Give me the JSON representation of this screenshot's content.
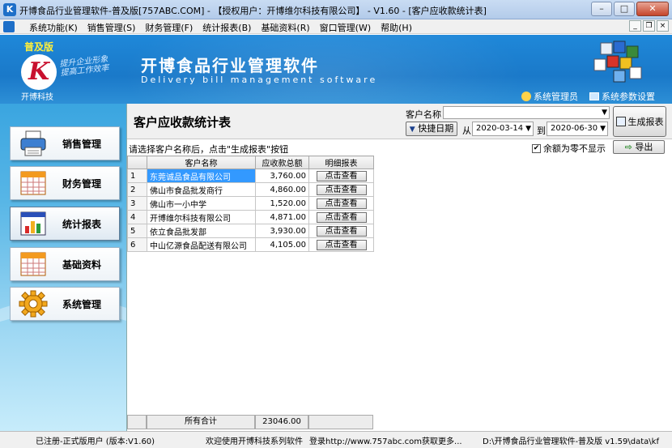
{
  "window": {
    "title": "开博食品行业管理软件-普及版[757ABC.COM] - 【授权用户：开博维尔科技有限公司】 - V1.60 - [客户应收款统计表]"
  },
  "menu": {
    "items": [
      "系统功能(K)",
      "销售管理(S)",
      "财务管理(F)",
      "统计报表(B)",
      "基础资料(R)",
      "窗口管理(W)",
      "帮助(H)"
    ]
  },
  "banner": {
    "edition": "普及版",
    "logo_letter": "K",
    "company": "开博科技",
    "slogan_line1": "提升企业形象",
    "slogan_line2": "提高工作效率",
    "app_title": "开博食品行业管理软件",
    "app_subtitle": "Delivery bill management software",
    "user_label": "系统管理员",
    "settings_label": "系统参数设置"
  },
  "nav": {
    "items": [
      {
        "label": "销售管理",
        "icon": "printer-icon"
      },
      {
        "label": "财务管理",
        "icon": "calendar-icon"
      },
      {
        "label": "统计报表",
        "icon": "bar-chart-icon"
      },
      {
        "label": "基础资料",
        "icon": "spreadsheet-icon"
      },
      {
        "label": "系统管理",
        "icon": "gear-icon"
      }
    ]
  },
  "report": {
    "title": "客户应收款统计表",
    "customer_label": "客户名称",
    "customer_value": "",
    "quick_date_label": "快捷日期",
    "from_label": "从",
    "from_date": "2020-03-14",
    "to_label": "到",
    "to_date": "2020-06-30",
    "generate_label": "生成报表",
    "hint": "请选择客户名称后，点击\"生成报表\"按钮",
    "zero_label": "余额为零不显示",
    "zero_checked": true,
    "export_label": "导出"
  },
  "table": {
    "headers": [
      "",
      "客户名称",
      "应收款总额",
      "明细报表"
    ],
    "detail_button_label": "点击查看",
    "rows": [
      {
        "idx": "1",
        "name": "东莞诚品食品有限公司",
        "amount": "3,760.00"
      },
      {
        "idx": "2",
        "name": "佛山市食品批发商行",
        "amount": "4,860.00"
      },
      {
        "idx": "3",
        "name": "佛山市一小中学",
        "amount": "1,520.00"
      },
      {
        "idx": "4",
        "name": "开博维尔科技有限公司",
        "amount": "4,871.00"
      },
      {
        "idx": "5",
        "name": "依立食品批发部",
        "amount": "3,930.00"
      },
      {
        "idx": "6",
        "name": "中山亿源食品配送有限公司",
        "amount": "4,105.00"
      }
    ],
    "selected_row": 0,
    "total_label": "所有合计",
    "total_value": "23046.00"
  },
  "status": {
    "seg1": "已注册-正式版用户 (版本:V1.60)",
    "seg2": "欢迎使用开博科技系列软件",
    "seg3": "登录http://www.757abc.com获取更多...",
    "seg4": "D:\\开博食品行业管理软件-普及版 v1.59\\data\\kf"
  },
  "colors": {
    "banner_blue": "#1f88d9",
    "selection_blue": "#3399ff",
    "edition_yellow": "#ffef3a",
    "logo_red": "#c8102e"
  }
}
